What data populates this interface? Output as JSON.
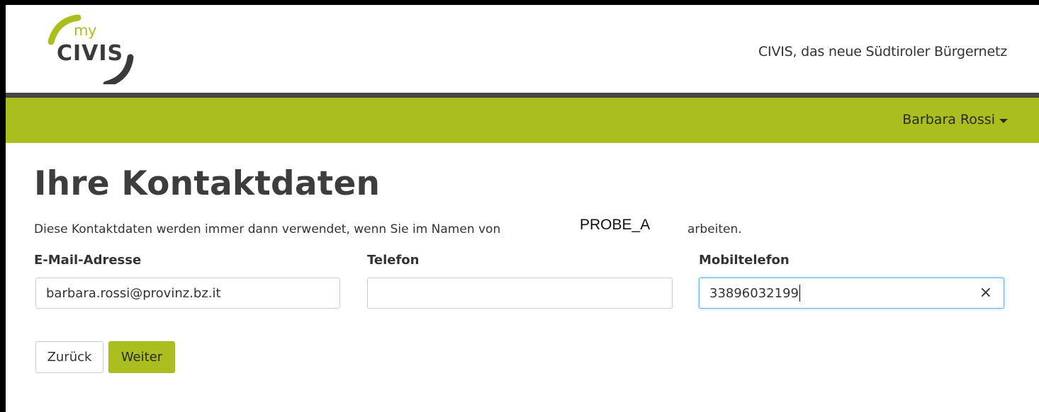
{
  "header": {
    "logo_my": "my",
    "logo_civis": "CIVIS",
    "tagline": "CIVIS, das neue Südtiroler Bürgernetz"
  },
  "nav": {
    "user_name": "Barbara Rossi"
  },
  "main": {
    "title": "Ihre Kontaktdaten",
    "intro_prefix": "Diese Kontaktdaten werden immer dann verwendet, wenn Sie im Namen von",
    "intro_entity": "PROBE_A",
    "intro_suffix": "arbeiten.",
    "fields": {
      "email": {
        "label": "E-Mail-Adresse",
        "value": "barbara.rossi@provinz.bz.it"
      },
      "phone": {
        "label": "Telefon",
        "value": ""
      },
      "mobile": {
        "label": "Mobiltelefon",
        "value": "33896032199",
        "clear_icon": "×"
      }
    },
    "buttons": {
      "back": "Zurück",
      "next": "Weiter"
    }
  },
  "colors": {
    "brand_green": "#aabf1f",
    "dark_rule": "#444444",
    "focus_border": "#66afe9"
  }
}
